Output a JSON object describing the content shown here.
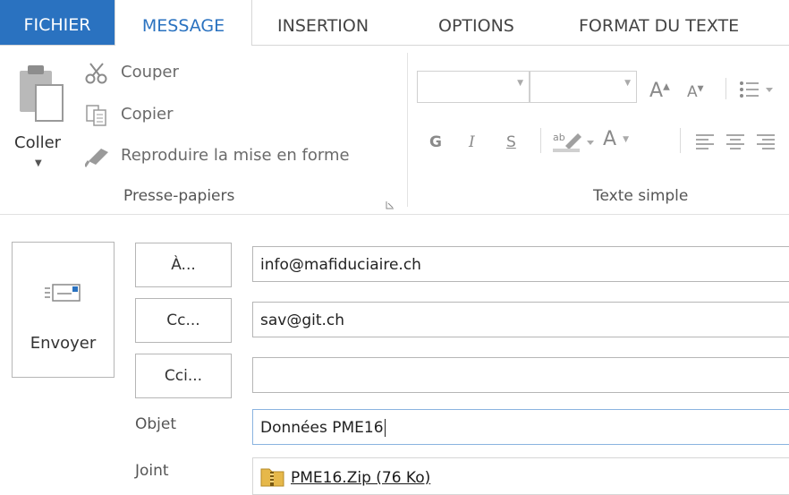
{
  "tabs": [
    {
      "label": "FICHIER"
    },
    {
      "label": "MESSAGE"
    },
    {
      "label": "INSERTION"
    },
    {
      "label": "OPTIONS"
    },
    {
      "label": "FORMAT DU TEXTE"
    }
  ],
  "ribbon": {
    "clipboard": {
      "paste_label": "Coller",
      "cut_label": "Couper",
      "copy_label": "Copier",
      "format_painter_label": "Reproduire la mise en forme",
      "group_label": "Presse-papiers"
    },
    "basic_text": {
      "grow_font": "A",
      "shrink_font": "A",
      "bold": "G",
      "italic": "I",
      "underline": "S",
      "font_color": "A",
      "group_label": "Texte simple"
    }
  },
  "compose": {
    "send_label": "Envoyer",
    "to_button": "À...",
    "cc_button": "Cc...",
    "bcc_button": "Cci...",
    "to_value": "info@mafiduciaire.ch",
    "cc_value": "sav@git.ch",
    "bcc_value": "",
    "subject_label": "Objet",
    "subject_value": "Données PME16",
    "attachment_label": "Joint",
    "attachment_name": "PME16.Zip (76 Ko)"
  },
  "colors": {
    "accent": "#2a72c0",
    "border": "#b6b6b6"
  }
}
